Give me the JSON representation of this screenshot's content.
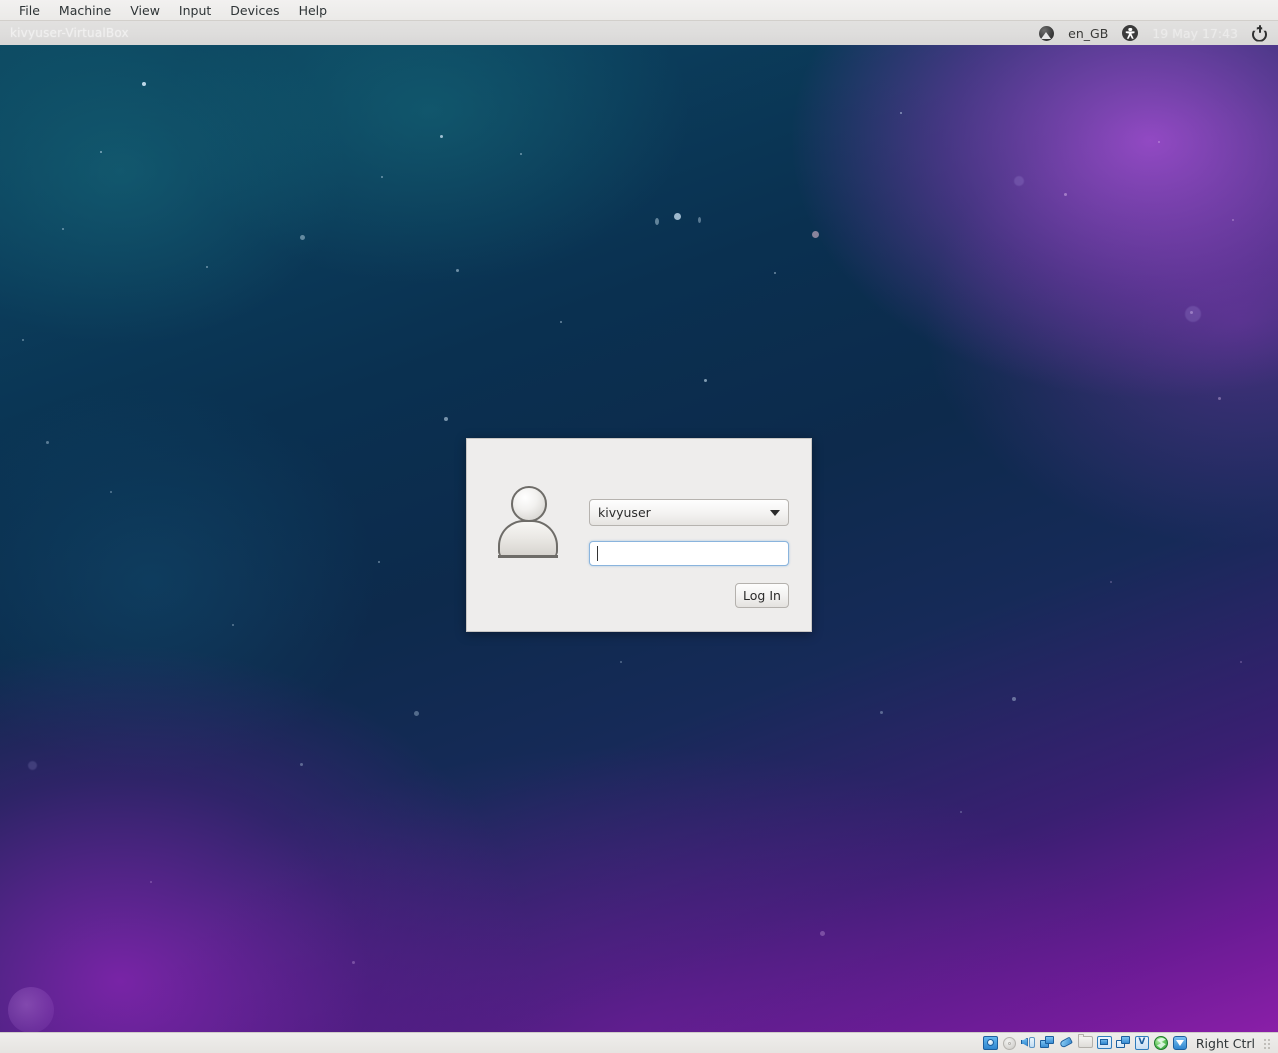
{
  "vbox": {
    "menu": [
      {
        "label": "File"
      },
      {
        "label": "Machine"
      },
      {
        "label": "View"
      },
      {
        "label": "Input"
      },
      {
        "label": "Devices"
      },
      {
        "label": "Help"
      }
    ],
    "statusbar": {
      "host_key_label": "Right Ctrl",
      "icons": [
        {
          "name": "hard-disk-icon",
          "title": "Hard Disks"
        },
        {
          "name": "optical-disk-icon",
          "title": "Optical Drives"
        },
        {
          "name": "audio-icon",
          "title": "Audio"
        },
        {
          "name": "network-icon",
          "title": "Network"
        },
        {
          "name": "usb-icon",
          "title": "USB Devices"
        },
        {
          "name": "shared-folders-icon",
          "title": "Shared Folders"
        },
        {
          "name": "display-icon",
          "title": "Display"
        },
        {
          "name": "recording-icon",
          "title": "Recording"
        },
        {
          "name": "virtualization-icon",
          "title": "Virtualization",
          "glyph": "V"
        },
        {
          "name": "globe-icon",
          "title": "Guest Additions"
        },
        {
          "name": "arrow-down-icon",
          "title": "Host Drag and Drop"
        }
      ]
    }
  },
  "guest": {
    "panel": {
      "hostname": "kivyuser-VirtualBox",
      "language": "en_GB",
      "clock": "19 May 17:43",
      "session_icon": "session-indicator-icon",
      "accessibility_icon": "accessibility-icon",
      "power_icon": "power-icon"
    },
    "login": {
      "avatar_icon": "user-avatar-icon",
      "username": "kivyuser",
      "password_value": "",
      "password_placeholder": "",
      "login_button_label": "Log In",
      "dropdown_icon": "chevron-down-icon"
    }
  },
  "colors": {
    "panel_background": "#dedddc",
    "dialog_background": "#eeedec",
    "focus_border": "#8ab4dd",
    "wallpaper_blue": "#0b3e5c",
    "wallpaper_purple": "#8a1fa8",
    "status_icon_blue": "#2f86cf"
  }
}
